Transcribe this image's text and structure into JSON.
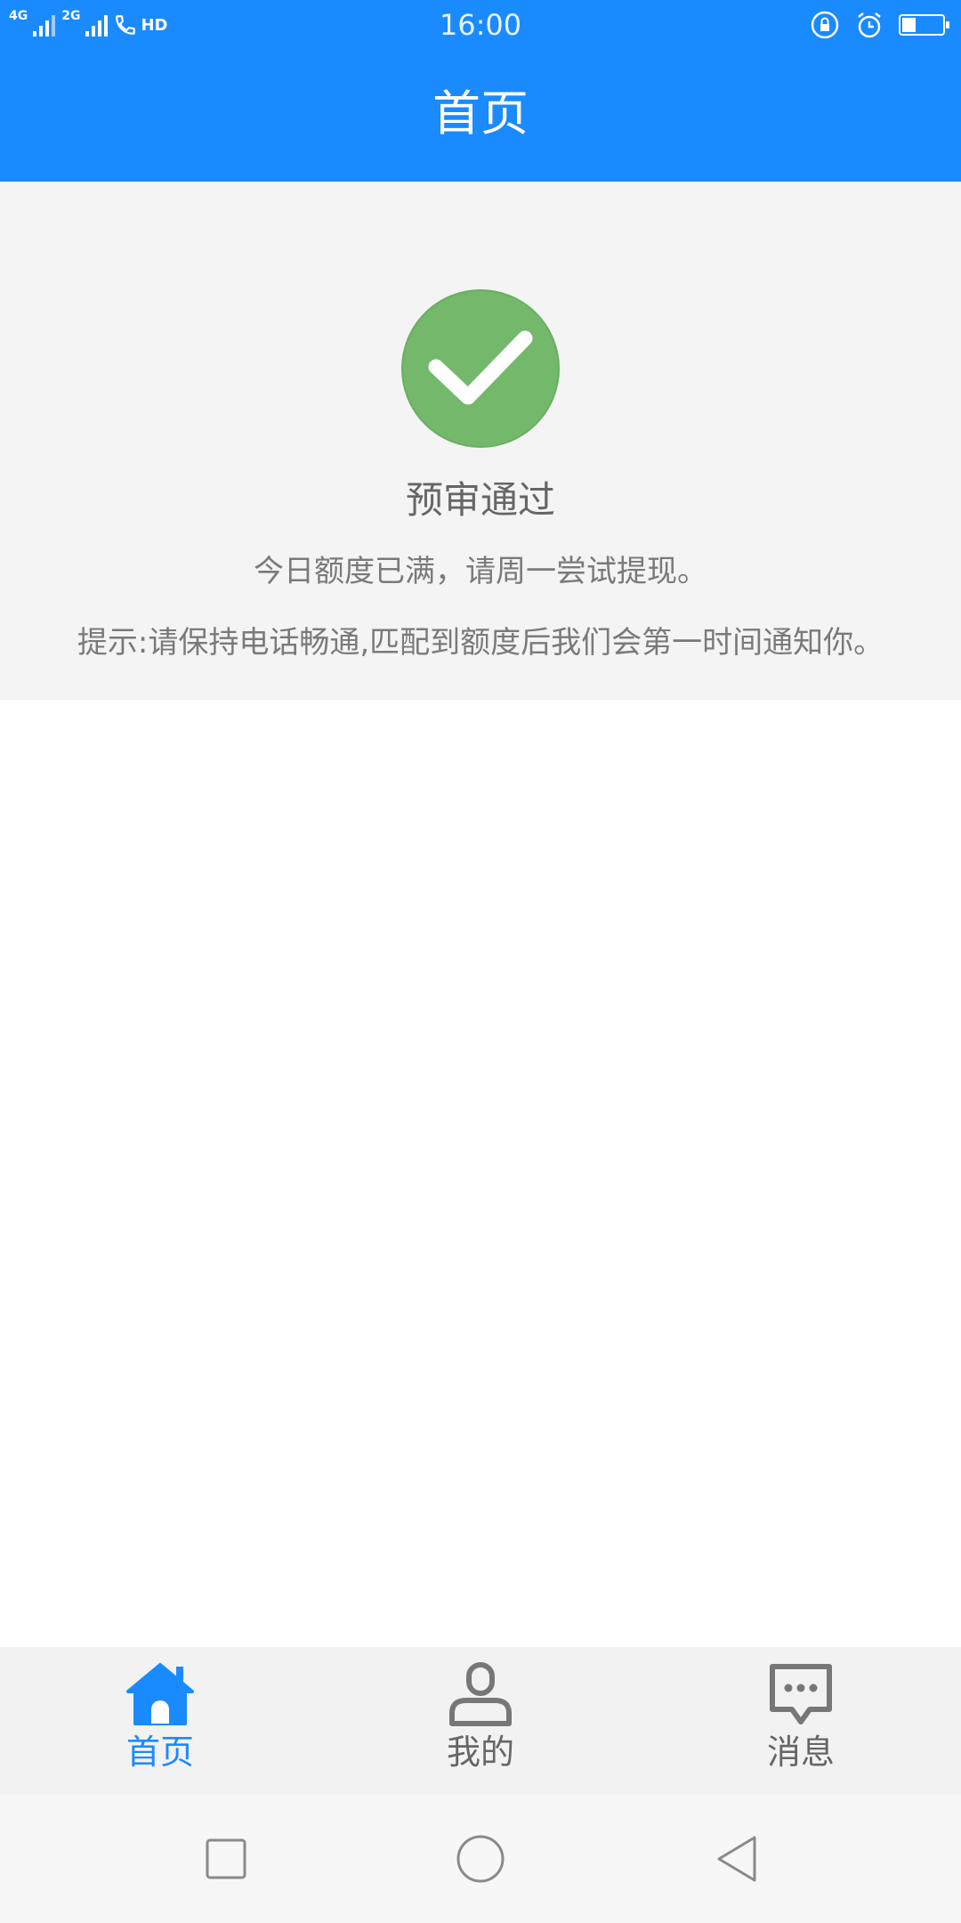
{
  "status_bar": {
    "network_1": "4G",
    "network_2": "2G",
    "hd": "HD",
    "time": "16:00",
    "battery_level": 0.35
  },
  "header": {
    "title": "首页"
  },
  "result": {
    "icon": "check-circle-icon",
    "title": "预审通过",
    "message": "今日额度已满，请周一尝试提现。",
    "tip": "提示:请保持电话畅通,匹配到额度后我们会第一时间通知你。"
  },
  "tabs": [
    {
      "label": "首页",
      "icon": "home-icon",
      "active": true
    },
    {
      "label": "我的",
      "icon": "person-icon",
      "active": false
    },
    {
      "label": "消息",
      "icon": "message-icon",
      "active": false
    }
  ],
  "colors": {
    "brand": "#1a8aff",
    "success": "#74b96b",
    "tab_inactive": "#777777"
  }
}
